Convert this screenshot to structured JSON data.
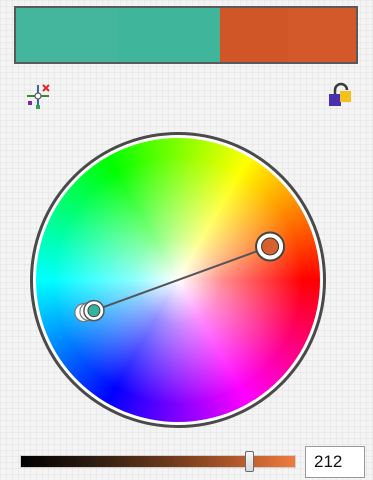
{
  "swatches": [
    {
      "name": "teal",
      "color": "#3fb59b",
      "shade_color": "#46b89f",
      "weight": 60
    },
    {
      "name": "orange",
      "color": "#d3582a",
      "shade_color": "#cf5326",
      "weight": 40
    }
  ],
  "toolbar": {
    "left_icon": "harmony-rule-icon",
    "right_icon": "lock-color-icon"
  },
  "wheel": {
    "handles": [
      {
        "name": "primary-handle",
        "color": "#d6602f",
        "hue_deg": 20,
        "radius_fraction": 0.69,
        "selected": true
      },
      {
        "name": "secondary-handle",
        "color": "#35b39f",
        "hue_deg": 200,
        "radius_fraction": 0.63,
        "selected": false
      }
    ],
    "connector_color": "#555555"
  },
  "brightness": {
    "value": "212",
    "max": 255,
    "start_color": "#000000",
    "end_color": "#f07a3e"
  }
}
